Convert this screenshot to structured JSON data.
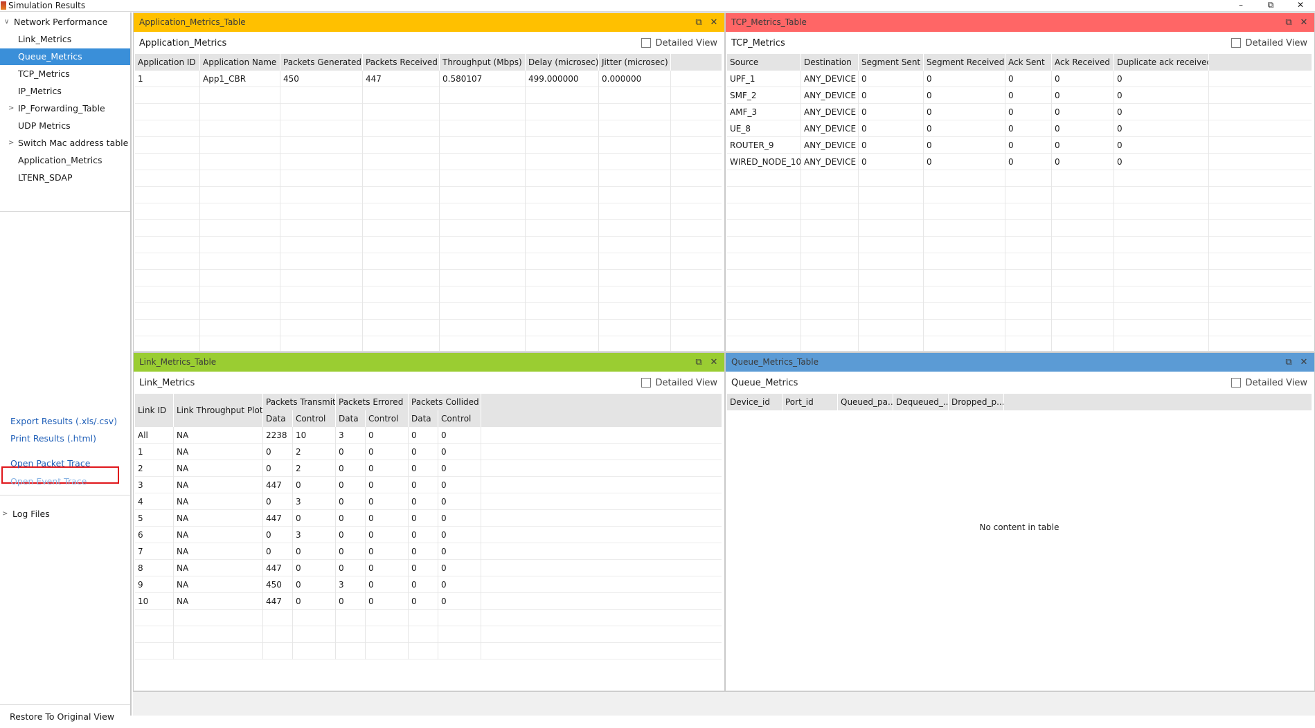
{
  "window": {
    "title": "Simulation Results",
    "min": "–",
    "max": "⧉",
    "close": "✕"
  },
  "sidebar": {
    "root_label": "Network Performance",
    "items": [
      {
        "label": "Link_Metrics",
        "expandable": false
      },
      {
        "label": "Queue_Metrics",
        "expandable": false,
        "selected": true
      },
      {
        "label": "TCP_Metrics",
        "expandable": false
      },
      {
        "label": "IP_Metrics",
        "expandable": false
      },
      {
        "label": "IP_Forwarding_Table",
        "expandable": true
      },
      {
        "label": "UDP Metrics",
        "expandable": false
      },
      {
        "label": "Switch Mac address table",
        "expandable": true
      },
      {
        "label": "Application_Metrics",
        "expandable": false
      },
      {
        "label": "LTENR_SDAP",
        "expandable": false
      }
    ],
    "export_label": "Export Results (.xls/.csv)",
    "print_label": "Print Results (.html)",
    "packet_trace_label": "Open Packet Trace",
    "event_trace_label": "Open Event Trace",
    "log_files_label": "Log Files",
    "restore_label": "Restore To Original View"
  },
  "panels": {
    "app": {
      "header": "Application_Metrics_Table",
      "subtitle": "Application_Metrics",
      "detailed_view": "Detailed View",
      "header_color": "#ffc000",
      "columns": [
        "Application ID",
        "Application Name",
        "Packets Generated",
        "Packets Received",
        "Throughput (Mbps)",
        "Delay (microsec)",
        "Jitter (microsec)"
      ],
      "rows": [
        [
          "1",
          "App1_CBR",
          "450",
          "447",
          "0.580107",
          "499.000000",
          "0.000000"
        ]
      ]
    },
    "tcp": {
      "header": "TCP_Metrics_Table",
      "subtitle": "TCP_Metrics",
      "detailed_view": "Detailed View",
      "header_color": "#ff6666",
      "columns": [
        "Source",
        "Destination",
        "Segment Sent",
        "Segment Received",
        "Ack Sent",
        "Ack Received",
        "Duplicate ack received"
      ],
      "rows": [
        [
          "UPF_1",
          "ANY_DEVICE",
          "0",
          "0",
          "0",
          "0",
          "0"
        ],
        [
          "SMF_2",
          "ANY_DEVICE",
          "0",
          "0",
          "0",
          "0",
          "0"
        ],
        [
          "AMF_3",
          "ANY_DEVICE",
          "0",
          "0",
          "0",
          "0",
          "0"
        ],
        [
          "UE_8",
          "ANY_DEVICE",
          "0",
          "0",
          "0",
          "0",
          "0"
        ],
        [
          "ROUTER_9",
          "ANY_DEVICE",
          "0",
          "0",
          "0",
          "0",
          "0"
        ],
        [
          "WIRED_NODE_10",
          "ANY_DEVICE",
          "0",
          "0",
          "0",
          "0",
          "0"
        ]
      ]
    },
    "link": {
      "header": "Link_Metrics_Table",
      "subtitle": "Link_Metrics",
      "detailed_view": "Detailed View",
      "header_color": "#9acd32",
      "group_columns": [
        "Link ID",
        "Link Throughput Plot",
        "Packets Transmit...",
        "Packets Errored",
        "Packets Collided"
      ],
      "sub_columns": [
        "Data",
        "Control",
        "Data",
        "Control",
        "Data",
        "Control"
      ],
      "rows": [
        [
          "All",
          "NA",
          "2238",
          "10",
          "3",
          "0",
          "0",
          "0"
        ],
        [
          "1",
          "NA",
          "0",
          "2",
          "0",
          "0",
          "0",
          "0"
        ],
        [
          "2",
          "NA",
          "0",
          "2",
          "0",
          "0",
          "0",
          "0"
        ],
        [
          "3",
          "NA",
          "447",
          "0",
          "0",
          "0",
          "0",
          "0"
        ],
        [
          "4",
          "NA",
          "0",
          "3",
          "0",
          "0",
          "0",
          "0"
        ],
        [
          "5",
          "NA",
          "447",
          "0",
          "0",
          "0",
          "0",
          "0"
        ],
        [
          "6",
          "NA",
          "0",
          "3",
          "0",
          "0",
          "0",
          "0"
        ],
        [
          "7",
          "NA",
          "0",
          "0",
          "0",
          "0",
          "0",
          "0"
        ],
        [
          "8",
          "NA",
          "447",
          "0",
          "0",
          "0",
          "0",
          "0"
        ],
        [
          "9",
          "NA",
          "450",
          "0",
          "3",
          "0",
          "0",
          "0"
        ],
        [
          "10",
          "NA",
          "447",
          "0",
          "0",
          "0",
          "0",
          "0"
        ]
      ]
    },
    "queue": {
      "header": "Queue_Metrics_Table",
      "subtitle": "Queue_Metrics",
      "detailed_view": "Detailed View",
      "header_color": "#5b9bd5",
      "columns": [
        "Device_id",
        "Port_id",
        "Queued_pa...",
        "Dequeued_...",
        "Dropped_p..."
      ],
      "empty_text": "No content in table"
    }
  }
}
